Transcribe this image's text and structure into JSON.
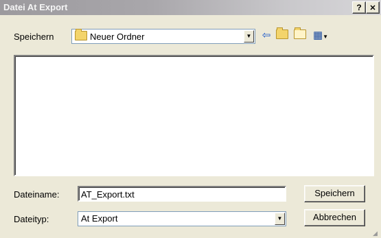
{
  "window": {
    "title": "Datei At Export",
    "help_label": "?",
    "close_label": "✕"
  },
  "save_in": {
    "label": "Speichern",
    "folder": "Neuer Ordner"
  },
  "toolbar": {
    "back_icon": "⇦",
    "up_icon": "⬏",
    "new_folder_icon": "✱",
    "view_menu_icon": "▦"
  },
  "filename": {
    "label": "Dateiname:",
    "value": "AT_Export.txt"
  },
  "filetype": {
    "label": "Dateityp:",
    "value": "At Export"
  },
  "buttons": {
    "save": "Speichern",
    "cancel": "Abbrechen"
  }
}
